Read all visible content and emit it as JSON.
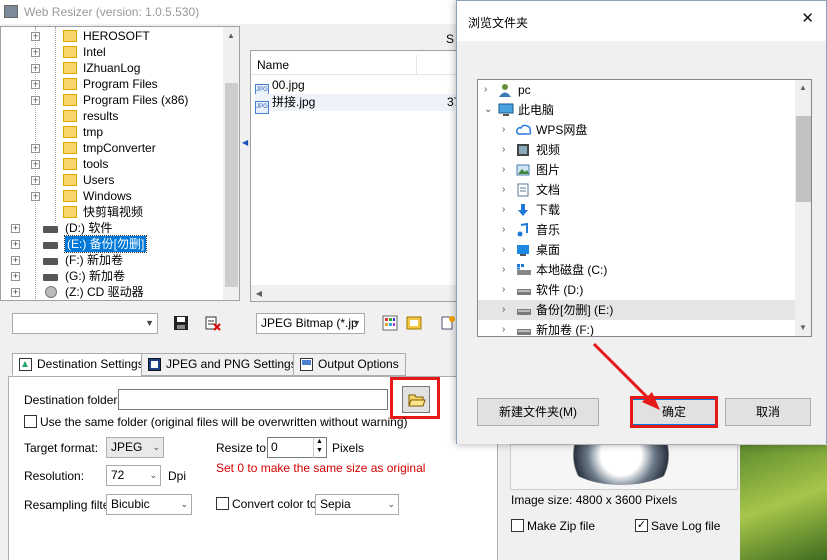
{
  "app": {
    "title": "Web Resizer (version: 1.0.5.530)"
  },
  "folder_tree": {
    "items": [
      {
        "label": "HEROSOFT",
        "kind": "folder",
        "expander": "+"
      },
      {
        "label": "Intel",
        "kind": "folder",
        "expander": "+"
      },
      {
        "label": "IZhuanLog",
        "kind": "folder",
        "expander": "+"
      },
      {
        "label": "Program Files",
        "kind": "folder",
        "expander": "+"
      },
      {
        "label": "Program Files (x86)",
        "kind": "folder",
        "expander": "+"
      },
      {
        "label": "results",
        "kind": "folder",
        "expander": ""
      },
      {
        "label": "tmp",
        "kind": "folder",
        "expander": ""
      },
      {
        "label": "tmpConverter",
        "kind": "folder",
        "expander": "+"
      },
      {
        "label": "tools",
        "kind": "folder",
        "expander": "+"
      },
      {
        "label": "Users",
        "kind": "folder",
        "expander": "+"
      },
      {
        "label": "Windows",
        "kind": "folder",
        "expander": "+"
      },
      {
        "label": "快剪辑视频",
        "kind": "folder",
        "expander": ""
      },
      {
        "label": "(D:) 软件",
        "kind": "drive",
        "expander": "+"
      },
      {
        "label": "(E:) 备份[勿删]",
        "kind": "drive",
        "expander": "+",
        "selected": true
      },
      {
        "label": "(F:) 新加卷",
        "kind": "drive",
        "expander": "+"
      },
      {
        "label": "(G:) 新加卷",
        "kind": "drive",
        "expander": "+"
      },
      {
        "label": "(Z:) CD 驱动器",
        "kind": "cd",
        "expander": "+"
      }
    ]
  },
  "file_list": {
    "header_fragment": "S",
    "columns": [
      "Name",
      ""
    ],
    "rows": [
      {
        "name": "00.jpg",
        "size": ""
      },
      {
        "name": "拼接.jpg",
        "size": "37"
      }
    ]
  },
  "toolbar": {
    "profile_value": "",
    "format_value": "JPEG Bitmap (*.jp"
  },
  "tabs": [
    {
      "label": "Destination Settings",
      "active": true
    },
    {
      "label": "JPEG and PNG Settings",
      "active": false
    },
    {
      "label": "Output Options",
      "active": false
    }
  ],
  "destination": {
    "folder_label": "Destination folder:",
    "folder_value": "",
    "same_folder_label": "Use the same folder (original files will be overwritten without warning)",
    "target_format_label": "Target format:",
    "target_format_value": "JPEG",
    "resize_label": "Resize to:",
    "resize_value": "0",
    "resize_unit": "Pixels",
    "resize_hint": "Set 0 to make the same size as original",
    "resolution_label": "Resolution:",
    "resolution_value": "72",
    "resolution_unit": "Dpi",
    "resampling_label": "Resampling filter:",
    "resampling_value": "Bicubic",
    "convert_label": "Convert color to:",
    "convert_value": "Sepia"
  },
  "preview": {
    "image_size": "Image size: 4800 x 3600 Pixels",
    "make_zip_label": "Make Zip file",
    "make_zip_checked": false,
    "save_log_label": "Save Log file",
    "save_log_checked": true
  },
  "dialog": {
    "title": "浏览文件夹",
    "close_glyph": "✕",
    "items": [
      {
        "label": "pc",
        "icon": "user-icon",
        "chevron": "›",
        "indent": 0
      },
      {
        "label": "此电脑",
        "icon": "computer-icon",
        "chevron": "⌄",
        "indent": 0
      },
      {
        "label": "WPS网盘",
        "icon": "cloud-icon",
        "chevron": "›",
        "indent": 1
      },
      {
        "label": "视频",
        "icon": "video-icon",
        "chevron": "›",
        "indent": 1
      },
      {
        "label": "图片",
        "icon": "picture-icon",
        "chevron": "›",
        "indent": 1
      },
      {
        "label": "文档",
        "icon": "document-icon",
        "chevron": "›",
        "indent": 1
      },
      {
        "label": "下载",
        "icon": "download-icon",
        "chevron": "›",
        "indent": 1
      },
      {
        "label": "音乐",
        "icon": "music-icon",
        "chevron": "›",
        "indent": 1
      },
      {
        "label": "桌面",
        "icon": "desktop-icon",
        "chevron": "›",
        "indent": 1
      },
      {
        "label": "本地磁盘 (C:)",
        "icon": "windows-drive-icon",
        "chevron": "›",
        "indent": 1
      },
      {
        "label": "软件 (D:)",
        "icon": "drive-icon",
        "chevron": "›",
        "indent": 1
      },
      {
        "label": "备份[勿删] (E:)",
        "icon": "drive-icon",
        "chevron": "›",
        "indent": 1,
        "highlighted": true
      },
      {
        "label": "新加卷 (F:)",
        "icon": "drive-icon",
        "chevron": "›",
        "indent": 1
      }
    ],
    "new_folder_label": "新建文件夹(M)",
    "ok_label": "确定",
    "cancel_label": "取消"
  },
  "colors": {
    "selection": "#0078d7",
    "annotation": "#e61919",
    "hint_text": "#d40000",
    "folder": "#f7d56a"
  }
}
